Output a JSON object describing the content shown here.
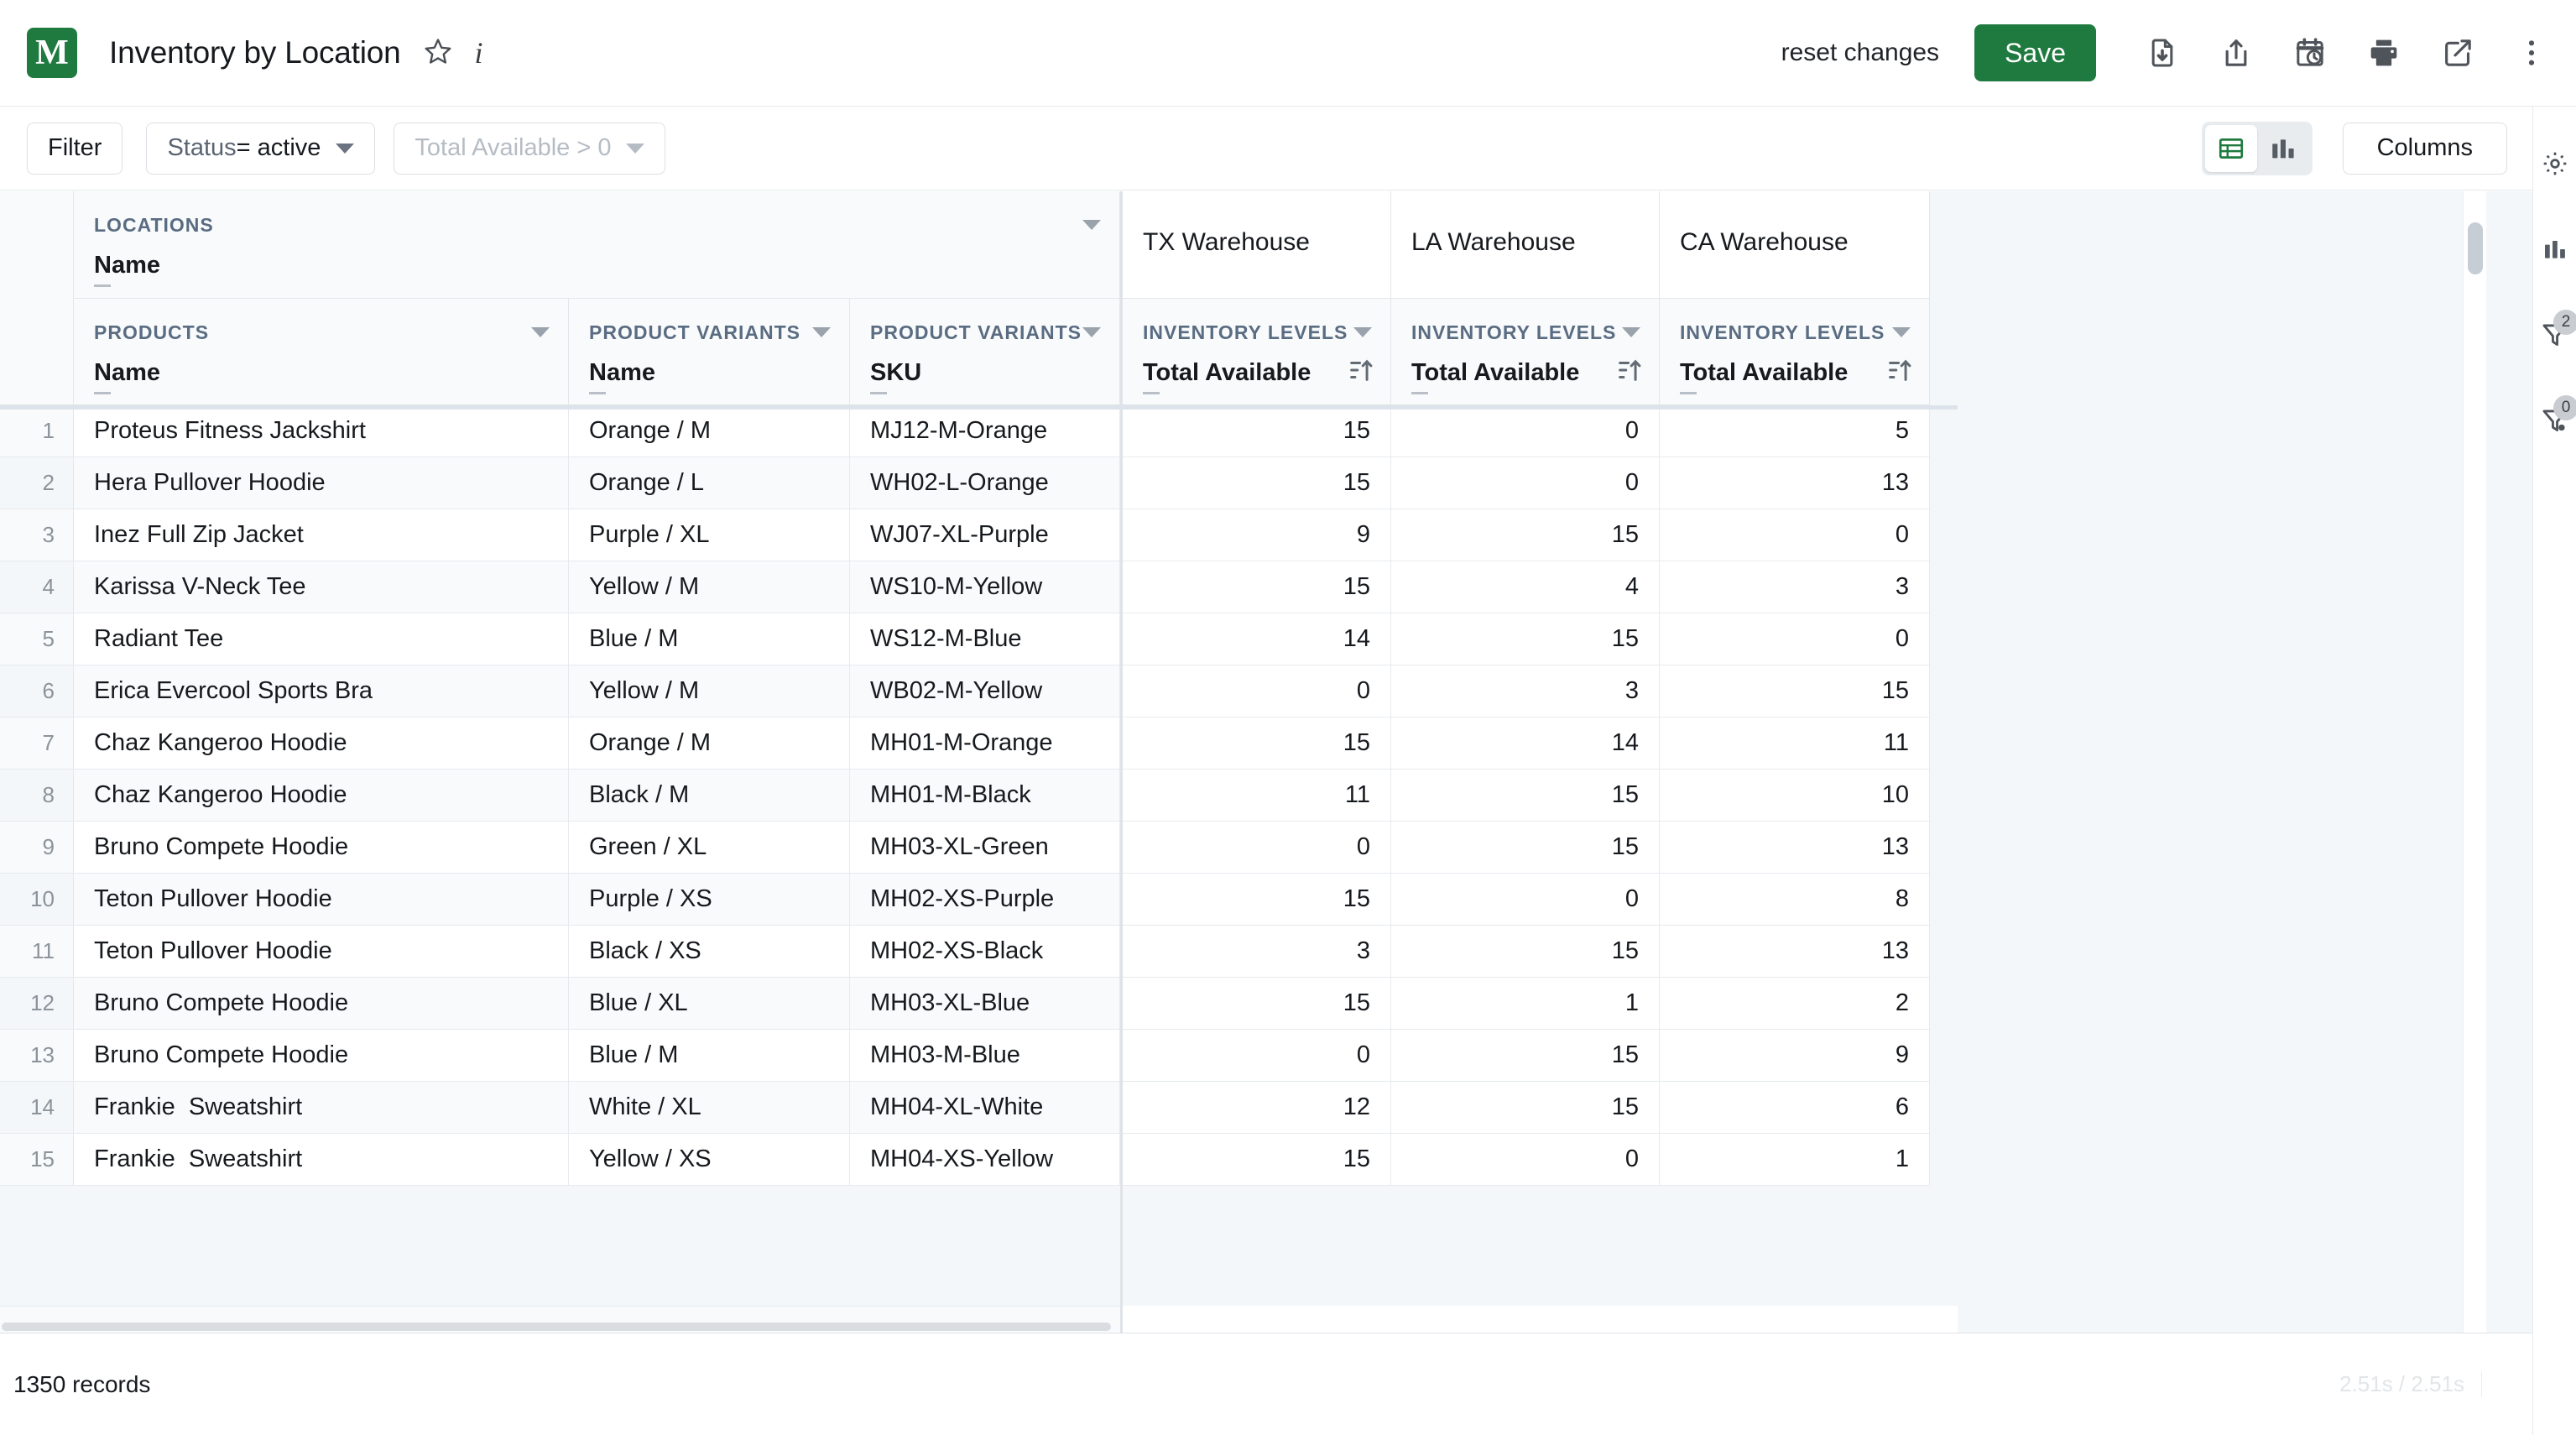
{
  "app": {
    "logo_letter": "M",
    "logo_color": "#1f7a3f",
    "title": "Inventory by Location",
    "star_icon": "star-outline-icon",
    "info_icon": "i"
  },
  "toolbar": {
    "reset_label": "reset changes",
    "save_label": "Save",
    "icons": [
      {
        "name": "download-file-icon"
      },
      {
        "name": "share-upload-icon"
      },
      {
        "name": "schedule-clock-icon"
      },
      {
        "name": "print-icon"
      },
      {
        "name": "open-external-icon"
      },
      {
        "name": "more-vertical-icon"
      }
    ]
  },
  "filter_bar": {
    "filter_label": "Filter",
    "chips": [
      {
        "key": "Status ",
        "value": "= active",
        "muted": false
      },
      {
        "key": "",
        "value": "Total Available > 0",
        "muted": true
      }
    ],
    "view_toggle": [
      {
        "name": "table-view-icon",
        "active": true
      },
      {
        "name": "chart-view-icon",
        "active": false
      }
    ],
    "columns_label": "Columns"
  },
  "right_rail": [
    {
      "name": "gear-icon",
      "badge": null
    },
    {
      "name": "bar-chart-icon",
      "badge": null
    },
    {
      "name": "filter-icon",
      "badge": "2"
    },
    {
      "name": "filter-settings-icon",
      "badge": "0"
    }
  ],
  "grid": {
    "header_groups": [
      {
        "name": "locations-group",
        "label": "LOCATIONS",
        "field": "Name",
        "has_caret": true
      },
      {
        "name": "products-group",
        "label": "PRODUCTS",
        "field": "Name",
        "has_caret": true
      },
      {
        "name": "product-variants-name-group",
        "label": "PRODUCT VARIANTS",
        "field": "Name",
        "has_caret": true
      },
      {
        "name": "product-variants-sku-group",
        "label": "PRODUCT VARIANTS",
        "field": "SKU",
        "has_caret": true
      }
    ],
    "warehouses": [
      {
        "name": "TX Warehouse",
        "group": "INVENTORY LEVELS",
        "field": "Total Available"
      },
      {
        "name": "LA Warehouse",
        "group": "INVENTORY LEVELS",
        "field": "Total Available"
      },
      {
        "name": "CA Warehouse",
        "group": "INVENTORY LEVELS",
        "field": "Total Available"
      }
    ],
    "rows": [
      {
        "n": "1",
        "product": "Proteus Fitness Jackshirt",
        "variant": "Orange / M",
        "sku": "MJ12-M-Orange",
        "tx": "15",
        "la": "0",
        "ca": "5"
      },
      {
        "n": "2",
        "product": "Hera Pullover Hoodie",
        "variant": "Orange / L",
        "sku": "WH02-L-Orange",
        "tx": "15",
        "la": "0",
        "ca": "13"
      },
      {
        "n": "3",
        "product": "Inez Full Zip Jacket",
        "variant": "Purple / XL",
        "sku": "WJ07-XL-Purple",
        "tx": "9",
        "la": "15",
        "ca": "0"
      },
      {
        "n": "4",
        "product": "Karissa V-Neck Tee",
        "variant": "Yellow / M",
        "sku": "WS10-M-Yellow",
        "tx": "15",
        "la": "4",
        "ca": "3"
      },
      {
        "n": "5",
        "product": "Radiant Tee",
        "variant": "Blue / M",
        "sku": "WS12-M-Blue",
        "tx": "14",
        "la": "15",
        "ca": "0"
      },
      {
        "n": "6",
        "product": "Erica Evercool Sports Bra",
        "variant": "Yellow / M",
        "sku": "WB02-M-Yellow",
        "tx": "0",
        "la": "3",
        "ca": "15"
      },
      {
        "n": "7",
        "product": "Chaz Kangeroo Hoodie",
        "variant": "Orange / M",
        "sku": "MH01-M-Orange",
        "tx": "15",
        "la": "14",
        "ca": "11"
      },
      {
        "n": "8",
        "product": "Chaz Kangeroo Hoodie",
        "variant": "Black / M",
        "sku": "MH01-M-Black",
        "tx": "11",
        "la": "15",
        "ca": "10"
      },
      {
        "n": "9",
        "product": "Bruno Compete Hoodie",
        "variant": "Green / XL",
        "sku": "MH03-XL-Green",
        "tx": "0",
        "la": "15",
        "ca": "13"
      },
      {
        "n": "10",
        "product": "Teton Pullover Hoodie",
        "variant": "Purple / XS",
        "sku": "MH02-XS-Purple",
        "tx": "15",
        "la": "0",
        "ca": "8"
      },
      {
        "n": "11",
        "product": "Teton Pullover Hoodie",
        "variant": "Black / XS",
        "sku": "MH02-XS-Black",
        "tx": "3",
        "la": "15",
        "ca": "13"
      },
      {
        "n": "12",
        "product": "Bruno Compete Hoodie",
        "variant": "Blue / XL",
        "sku": "MH03-XL-Blue",
        "tx": "15",
        "la": "1",
        "ca": "2"
      },
      {
        "n": "13",
        "product": "Bruno Compete Hoodie",
        "variant": "Blue / M",
        "sku": "MH03-M-Blue",
        "tx": "0",
        "la": "15",
        "ca": "9"
      },
      {
        "n": "14",
        "product": "Frankie  Sweatshirt",
        "variant": "White / XL",
        "sku": "MH04-XL-White",
        "tx": "12",
        "la": "15",
        "ca": "6"
      },
      {
        "n": "15",
        "product": "Frankie  Sweatshirt",
        "variant": "Yellow / XS",
        "sku": "MH04-XS-Yellow",
        "tx": "15",
        "la": "0",
        "ca": "1"
      }
    ]
  },
  "footer": {
    "record_count": "1350 records",
    "timing": "2.51s / 2.51s"
  }
}
